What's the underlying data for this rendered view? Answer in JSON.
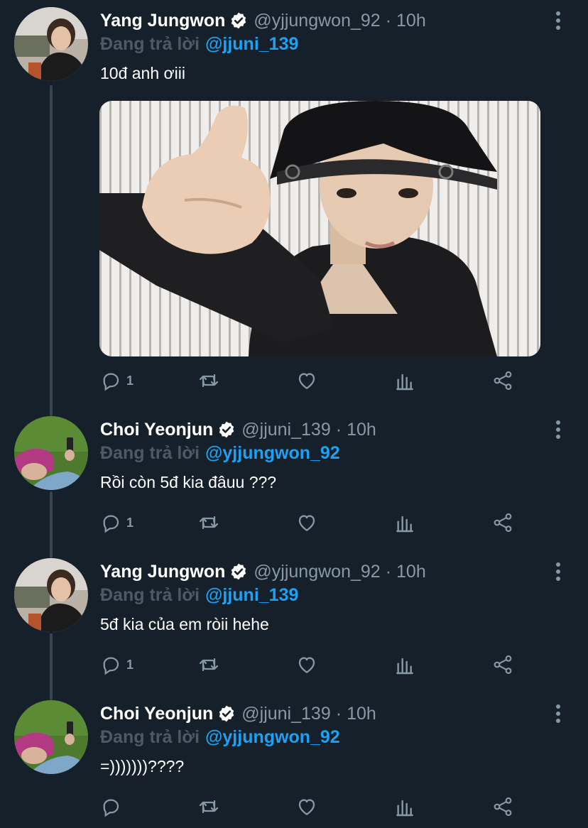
{
  "colors": {
    "background": "#15202b",
    "name": "#ffffff",
    "muted": "#8899a6",
    "replying_to_prefix": "#4b5a66",
    "mention": "#1da1f2",
    "thread_line": "#38444d"
  },
  "tweets": [
    {
      "display_name": "Yang Jungwon",
      "verified": true,
      "handle": "@yjjungwon_92",
      "separator": "·",
      "time": "10h",
      "replying_prefix": "Đang trả lời",
      "replying_to": "@jjuni_139",
      "text": "10đ anh ơiii",
      "has_media": true,
      "reply_count": "1",
      "icons": [
        "reply-icon",
        "retweet-icon",
        "like-icon",
        "analytics-icon",
        "share-icon"
      ]
    },
    {
      "display_name": "Choi Yeonjun",
      "verified": true,
      "handle": "@jjuni_139",
      "separator": "·",
      "time": "10h",
      "replying_prefix": "Đang trả lời",
      "replying_to": "@yjjungwon_92",
      "text": "Rồi còn 5đ kia đâuu ???",
      "has_media": false,
      "reply_count": "1"
    },
    {
      "display_name": "Yang Jungwon",
      "verified": true,
      "handle": "@yjjungwon_92",
      "separator": "·",
      "time": "10h",
      "replying_prefix": "Đang trả lời",
      "replying_to": "@jjuni_139",
      "text": "5đ kia của em ròii hehe",
      "has_media": false,
      "reply_count": "1"
    },
    {
      "display_name": "Choi Yeonjun",
      "verified": true,
      "handle": "@jjuni_139",
      "separator": "·",
      "time": "10h",
      "replying_prefix": "Đang trả lời",
      "replying_to": "@yjjungwon_92",
      "text": "=)))))))????",
      "has_media": false,
      "reply_count": ""
    }
  ]
}
